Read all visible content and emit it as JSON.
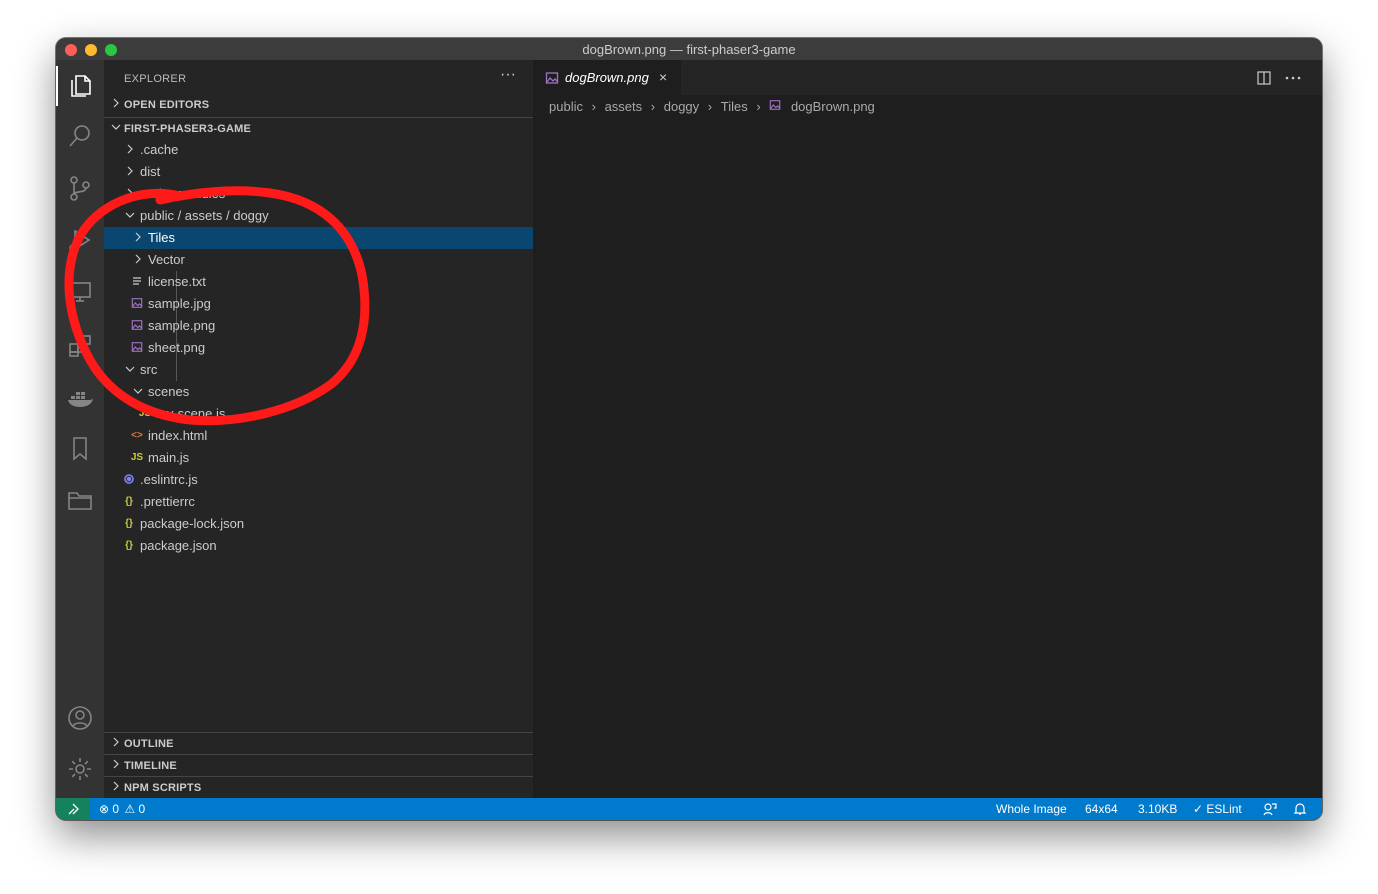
{
  "window": {
    "title": "dogBrown.png — first-phaser3-game"
  },
  "sidebar": {
    "header": "EXPLORER",
    "more": "···",
    "open_editors": "OPEN EDITORS",
    "project": "FIRST-PHASER3-GAME",
    "tree": [
      {
        "label": ".cache",
        "kind": "folder-closed"
      },
      {
        "label": "dist",
        "kind": "folder-closed"
      },
      {
        "label": "node_modules",
        "kind": "folder-closed"
      },
      {
        "label": "public / assets / doggy",
        "kind": "folder-open"
      },
      {
        "label": "Tiles",
        "kind": "folder-closed",
        "selected": true
      },
      {
        "label": "Vector",
        "kind": "folder-closed"
      },
      {
        "label": "license.txt",
        "kind": "text-file"
      },
      {
        "label": "sample.jpg",
        "kind": "image-file"
      },
      {
        "label": "sample.png",
        "kind": "image-file"
      },
      {
        "label": "sheet.png",
        "kind": "image-file"
      },
      {
        "label": "src",
        "kind": "folder-open"
      },
      {
        "label": "scenes",
        "kind": "folder-open"
      },
      {
        "label": "my-scene.js",
        "kind": "js-file",
        "icon_text": "JS"
      },
      {
        "label": "index.html",
        "kind": "html-file",
        "icon_text": "<>"
      },
      {
        "label": "main.js",
        "kind": "js-file",
        "icon_text": "JS"
      },
      {
        "label": ".eslintrc.js",
        "kind": "eslint-file"
      },
      {
        "label": ".prettierrc",
        "kind": "json-file",
        "icon_text": "{}"
      },
      {
        "label": "package-lock.json",
        "kind": "json-file",
        "icon_text": "{}"
      },
      {
        "label": "package.json",
        "kind": "json-file",
        "icon_text": "{}"
      }
    ],
    "outline": "OUTLINE",
    "timeline": "TIMELINE",
    "npm_scripts": "NPM SCRIPTS"
  },
  "editor": {
    "tab_label": "dogBrown.png",
    "tab_close": "×",
    "breadcrumbs": [
      "public",
      "assets",
      "doggy",
      "Tiles",
      "dogBrown.png"
    ]
  },
  "statusbar": {
    "errors": "0",
    "warnings": "0",
    "image_mode": "Whole Image",
    "dimensions": "64x64",
    "file_size": "3.10KB",
    "eslint": "ESLint"
  },
  "colors": {
    "status_bar": "#007acc",
    "selection": "#094771",
    "annotation": "#ff1a1a"
  }
}
